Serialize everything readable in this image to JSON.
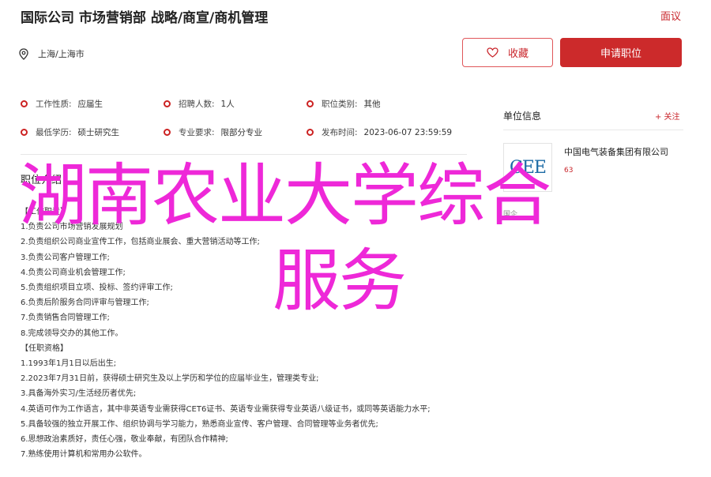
{
  "header": {
    "title": "国际公司 市场营销部 战略/商宣/商机管理",
    "report_label": "面议",
    "location": "上海/上海市",
    "favorite_label": "收藏",
    "apply_label": "申请职位"
  },
  "attributes": [
    {
      "key": "工作性质:",
      "value": "应届生"
    },
    {
      "key": "招聘人数:",
      "value": "1人"
    },
    {
      "key": "职位类别:",
      "value": "其他"
    },
    {
      "key": "最低学历:",
      "value": "硕士研究生"
    },
    {
      "key": "专业要求:",
      "value": "限部分专业"
    },
    {
      "key": "发布时间:",
      "value": "2023-06-07 23:59:59"
    }
  ],
  "section_title": "职位介绍",
  "description": [
    "【工作职责】",
    "1.负责公司市场营销发展规划",
    "2.负责组织公司商业宣传工作，包括商业展会、重大营销活动等工作;",
    "3.负责公司客户管理工作;",
    "4.负责公司商业机会管理工作;",
    "5.负责组织项目立项、投标、签约评审工作;",
    "6.负责后阶服务合同评审与管理工作;",
    "7.负责销售合同管理工作;",
    "8.完成领导交办的其他工作。",
    "【任职资格】",
    "1.1993年1月1日以后出生;",
    "2.2023年7月31日前，获得硕士研究生及以上学历和学位的应届毕业生，管理类专业;",
    "3.具备海外实习/生活经历者优先;",
    "4.英语可作为工作语言，其中非英语专业需获得CET6证书、英语专业需获得专业英语八级证书，或同等英语能力水平;",
    "5.具备较强的独立开展工作、组织协调与学习能力，熟悉商业宣传、客户管理、合同管理等业务者优先;",
    "6.思想政治素质好，责任心强，敬业奉献，有团队合作精神;",
    "7.熟练使用计算机和常用办公软件。"
  ],
  "company": {
    "section_label": "单位信息",
    "follow_label": "+ 关注",
    "logo_text": "CEE",
    "name": "中国电气装备集团有限公司",
    "sub": "63",
    "sub2": "国企"
  },
  "overlay": {
    "line1": "湖南农业大学综合",
    "line2": "服务"
  }
}
